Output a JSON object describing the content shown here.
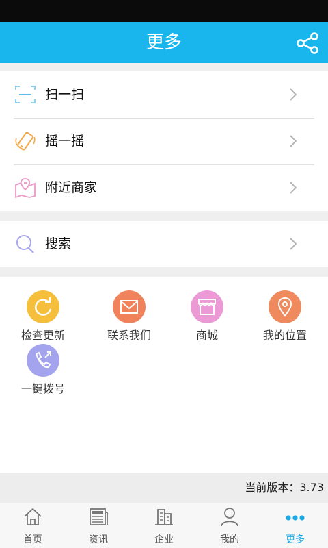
{
  "header": {
    "title": "更多"
  },
  "menu_group_1": [
    {
      "label": "扫一扫",
      "icon": "scan-icon"
    },
    {
      "label": "摇一摇",
      "icon": "shake-phone-icon"
    },
    {
      "label": "附近商家",
      "icon": "nearby-map-icon"
    }
  ],
  "menu_group_2": [
    {
      "label": "搜索",
      "icon": "search-icon"
    }
  ],
  "grid": [
    {
      "label": "检查更新",
      "icon": "refresh-icon",
      "color": "#f5bf3c"
    },
    {
      "label": "联系我们",
      "icon": "mail-icon",
      "color": "#f0835c"
    },
    {
      "label": "商城",
      "icon": "store-icon",
      "color": "#ec9ad5"
    },
    {
      "label": "我的位置",
      "icon": "location-pin-icon",
      "color": "#ef8a5e"
    },
    {
      "label": "一键拨号",
      "icon": "phone-icon",
      "color": "#a4a3ee"
    }
  ],
  "version": {
    "text": "当前版本：3.73"
  },
  "tabs": [
    {
      "label": "首页",
      "icon": "home-icon",
      "active": false
    },
    {
      "label": "资讯",
      "icon": "news-icon",
      "active": false
    },
    {
      "label": "企业",
      "icon": "buildings-icon",
      "active": false
    },
    {
      "label": "我的",
      "icon": "user-icon",
      "active": false
    },
    {
      "label": "更多",
      "icon": "more-dots-icon",
      "active": true
    }
  ],
  "colors": {
    "header": "#19b6ee",
    "active_tab": "#19a9e3"
  }
}
